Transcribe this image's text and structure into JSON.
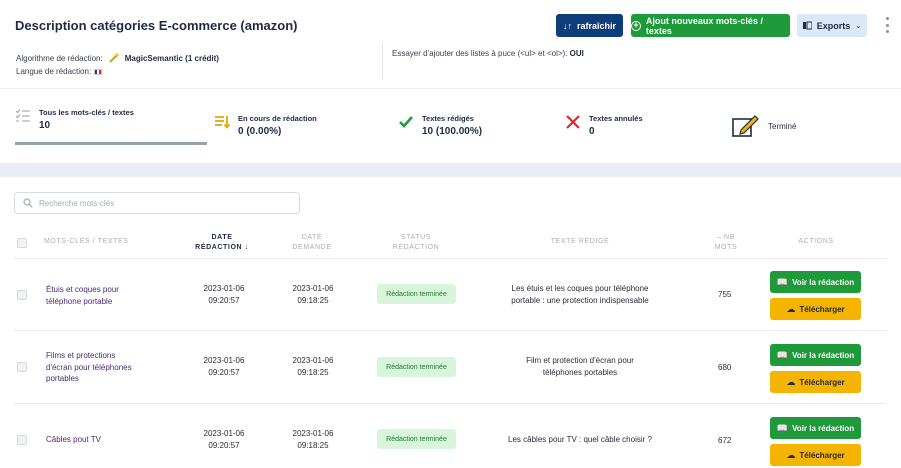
{
  "header": {
    "title": "Description catégories E-commerce (amazon)",
    "refresh_label": "rafraîchir",
    "add_label": "Ajout nouveaux mots-clés / textes",
    "export_label": "Exports"
  },
  "meta": {
    "algo_label": "Algorithme de rédaction:",
    "algo_value": "MagicSemantic (1 crédit)",
    "lang_label": "Langue de rédaction:",
    "lists_label": "Essayer d'ajouter des listes à puce (<ul> et <ol>):",
    "lists_value": "OUI"
  },
  "stats": [
    {
      "label": "Tous les mots-clés / textes",
      "value": "10"
    },
    {
      "label": "En cours de rédaction",
      "value": "0 (0.00%)"
    },
    {
      "label": "Textes rédigés",
      "value": "10 (100.00%)"
    },
    {
      "label": "Textes annulés",
      "value": "0"
    },
    {
      "label": "Terminé",
      "value": ""
    }
  ],
  "search": {
    "placeholder": "Recherche mots-clés"
  },
  "table": {
    "columns": {
      "keywords": "MOTS-CLÉS / TEXTES",
      "date_redaction": "DATE\nRÉDACTION ↓",
      "date_demande": "DATE\nDEMANDE",
      "status": "STATUS\nRÉDACTION",
      "texte": "TEXTE RÉDIGÉ",
      "nb_mots": "– NB\nMOTS",
      "actions": "ACTIONS"
    },
    "rows": [
      {
        "keyword": "Étuis et coques pour\ntéléphone portable",
        "date_redaction": "2023-01-06\n09:20:57",
        "date_demande": "2023-01-06\n09:18:25",
        "status": "Rédaction terminée",
        "texte": "Les étuis et les coques pour téléphone\nportable : une protection indispensable",
        "nb_mots": "755",
        "view_label": "Voir la rédaction",
        "download_label": "Télécharger"
      },
      {
        "keyword": "Films et protections\nd'écran pour téléphones\nportables",
        "date_redaction": "2023-01-06\n09:20:57",
        "date_demande": "2023-01-06\n09:18:25",
        "status": "Rédaction terminée",
        "texte": "Film et protection d'écran pour\ntéléphones portables",
        "nb_mots": "680",
        "view_label": "Voir la rédaction",
        "download_label": "Télécharger"
      },
      {
        "keyword": "Câbles pout TV",
        "date_redaction": "2023-01-06\n09:20:57",
        "date_demande": "2023-01-06\n09:18:25",
        "status": "Rédaction terminée",
        "texte": "Les câbles pour TV : quel câble choisir ?",
        "nb_mots": "672",
        "view_label": "Voir la rédaction",
        "download_label": "Télécharger"
      }
    ]
  },
  "colors": {
    "primary": "#0f3d7a",
    "success": "#1e9a3a",
    "warning": "#f4b400",
    "danger": "#d62d2d"
  }
}
